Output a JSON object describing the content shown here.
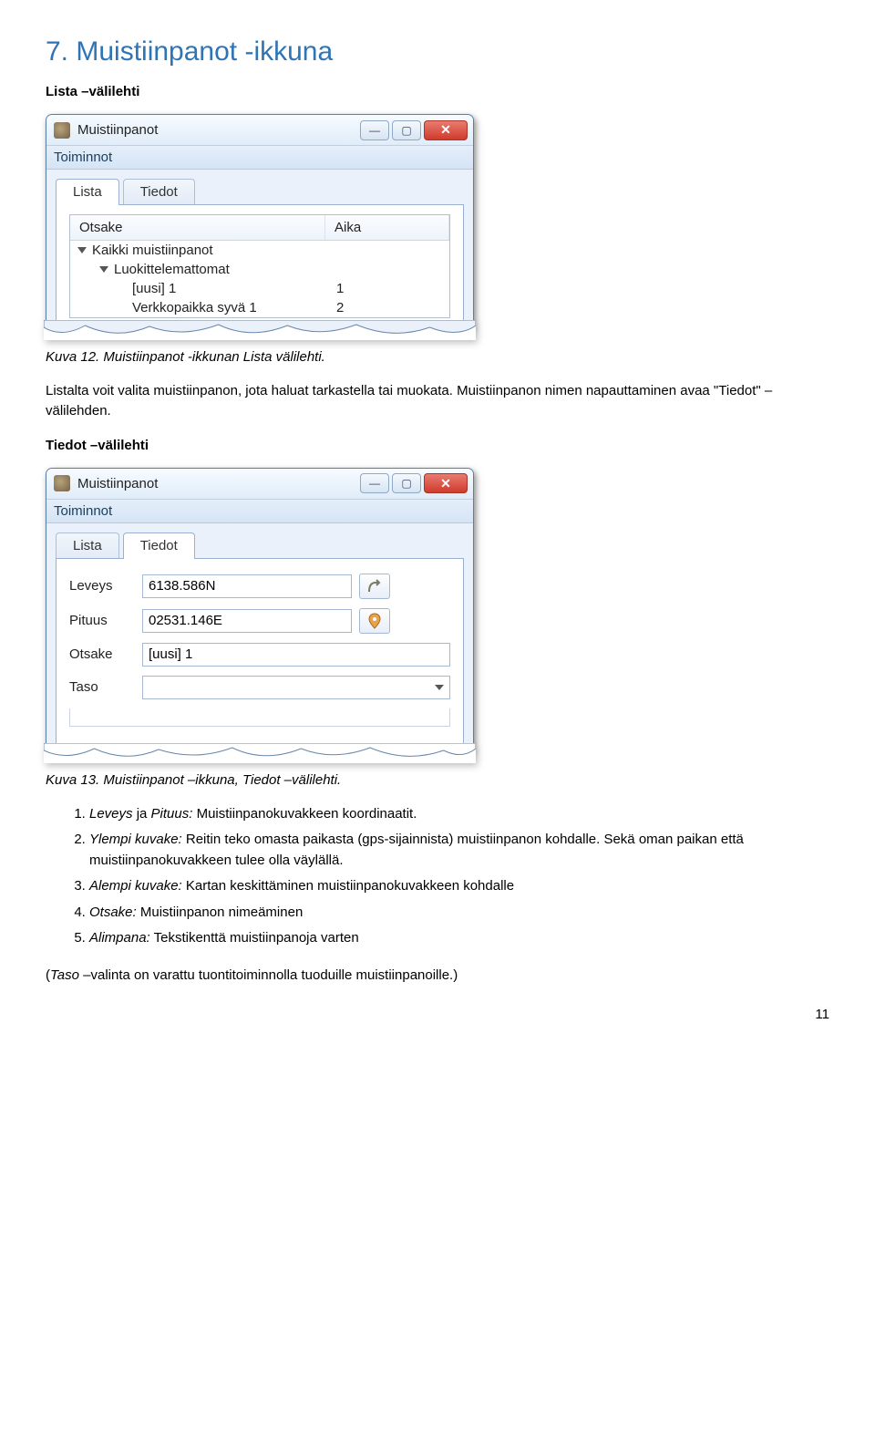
{
  "section": {
    "title": "7. Muistiinpanot -ikkuna",
    "sub_lista": "Lista –välilehti",
    "sub_tiedot": "Tiedot –välilehti"
  },
  "captions": {
    "fig12": "Kuva 12. Muistiinpanot -ikkunan Lista välilehti.",
    "fig13": "Kuva 13. Muistiinpanot –ikkuna, Tiedot –välilehti."
  },
  "paragraphs": {
    "after12": "Listalta voit valita muistiinpanon, jota haluat tarkastella tai muokata. Muistiinpanon nimen napauttaminen avaa \"Tiedot\" –välilehden."
  },
  "list": {
    "i1a": "Leveys",
    "i1b": " ja ",
    "i1c": "Pituus:",
    "i1d": "  Muistiinpanokuvakkeen koordinaatit.",
    "i2a": "Ylempi kuvake:",
    "i2b": "  Reitin teko omasta paikasta (gps-sijainnista) muistiinpanon kohdalle. Sekä oman paikan että muistiinpanokuvakkeen tulee olla väylällä.",
    "i3a": "Alempi kuvake:",
    "i3b": "  Kartan keskittäminen muistiinpanokuvakkeen kohdalle",
    "i4a": "Otsake:",
    "i4b": "  Muistiinpanon nimeäminen",
    "i5a": "Alimpana:",
    "i5b": "  Tekstikenttä muistiinpanoja varten"
  },
  "footnote_a": "(",
  "footnote_b": "Taso",
  "footnote_c": " –valinta on varattu tuontitoiminnolla tuoduille muistiinpanoille.)",
  "page_number": "11",
  "win1": {
    "title": "Muistiinpanot",
    "menu": "Toiminnot",
    "tab_lista": "Lista",
    "tab_tiedot": "Tiedot",
    "col_otsake": "Otsake",
    "col_aika": "Aika",
    "row1": "Kaikki muistiinpanot",
    "row2": "Luokittelemattomat",
    "row3a": "[uusi] 1",
    "row3b": "1",
    "row4a": "Verkkopaikka syvä 1",
    "row4b": "2"
  },
  "win2": {
    "title": "Muistiinpanot",
    "menu": "Toiminnot",
    "tab_lista": "Lista",
    "tab_tiedot": "Tiedot",
    "label_leveys": "Leveys",
    "label_pituus": "Pituus",
    "label_otsake": "Otsake",
    "label_taso": "Taso",
    "val_leveys": "6138.586N",
    "val_pituus": "02531.146E",
    "val_otsake": "[uusi] 1"
  }
}
